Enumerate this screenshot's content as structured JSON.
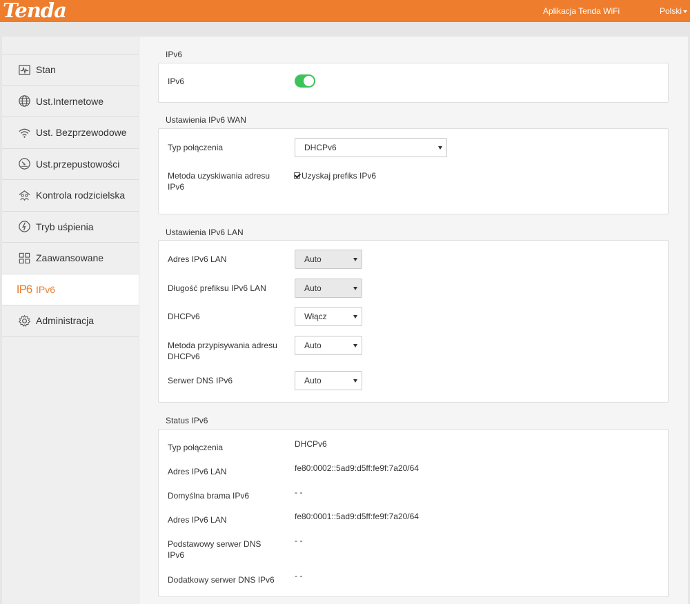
{
  "header": {
    "logo": "Tenda",
    "app_link": "Aplikacja Tenda WiFi",
    "language": "Polski"
  },
  "sidebar": {
    "items": [
      {
        "label": "Stan",
        "icon": "activity-icon"
      },
      {
        "label": "Ust.Internetowe",
        "icon": "globe-icon"
      },
      {
        "label": "Ust. Bezprzewodowe",
        "icon": "wifi-icon"
      },
      {
        "label": "Ust.przepustowości",
        "icon": "speedometer-icon"
      },
      {
        "label": "Kontrola rodzicielska",
        "icon": "family-icon"
      },
      {
        "label": "Tryb uśpienia",
        "icon": "sleep-icon"
      },
      {
        "label": "Zaawansowane",
        "icon": "grid-icon"
      },
      {
        "label": "IPv6",
        "icon": "ipv6-icon",
        "active": true
      },
      {
        "label": "Administracja",
        "icon": "gear-icon"
      }
    ],
    "ipv6_icon_text": "IP6"
  },
  "ipv6": {
    "title": "IPv6",
    "toggle_label": "IPv6",
    "enabled": true
  },
  "wan": {
    "title": "Ustawienia IPv6 WAN",
    "conn_type_label": "Typ połączenia",
    "conn_type_value": "DHCPv6",
    "method_label": "Metoda uzyskiwania adresu IPv6",
    "prefix_checkbox_label": "Uzyskaj prefiks IPv6",
    "prefix_checked": true
  },
  "lan": {
    "title": "Ustawienia IPv6 LAN",
    "rows": [
      {
        "label": "Adres IPv6 LAN",
        "value": "Auto"
      },
      {
        "label": "Długość prefiksu IPv6 LAN",
        "value": "Auto"
      },
      {
        "label": "DHCPv6",
        "value": "Włącz"
      },
      {
        "label": "Metoda przypisywania adresu DHCPv6",
        "value": "Auto"
      },
      {
        "label": "Serwer DNS IPv6",
        "value": "Auto"
      }
    ]
  },
  "status": {
    "title": "Status IPv6",
    "rows": [
      {
        "label": "Typ połączenia",
        "value": "DHCPv6"
      },
      {
        "label": "Adres IPv6 LAN",
        "value": "fe80:0002::5ad9:d5ff:fe9f:7a20/64"
      },
      {
        "label": "Domyślna brama IPv6",
        "value": "- -"
      },
      {
        "label": "Adres IPv6 LAN",
        "value": "fe80:0001::5ad9:d5ff:fe9f:7a20/64"
      },
      {
        "label": "Podstawowy serwer DNS IPv6",
        "value": "- -"
      },
      {
        "label": "Dodatkowy serwer DNS IPv6",
        "value": "- -"
      }
    ]
  },
  "colors": {
    "brand": "#ee7d2d",
    "toggle_on": "#3cc35a"
  }
}
